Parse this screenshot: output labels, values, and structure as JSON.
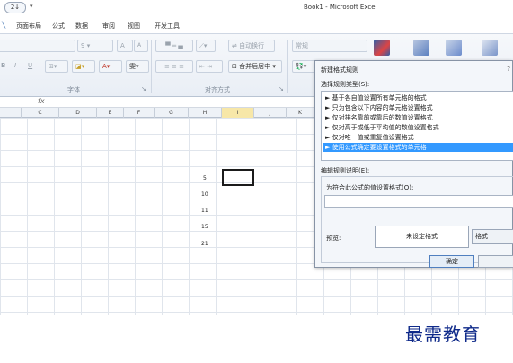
{
  "titlebar": {
    "sort_icon_text": "2↓",
    "title": "Book1 - Microsoft Excel"
  },
  "ribbon": {
    "tabs": [
      "页面布局",
      "公式",
      "数据",
      "审阅",
      "视图",
      "开发工具"
    ],
    "font_size": "9",
    "font_grow": "A",
    "font_shrink": "A",
    "wrap_text": "自动换行",
    "merge_center": "合并后居中",
    "number_format": "常规",
    "group_font": "字体",
    "group_alignment": "对齐方式"
  },
  "columns": [
    "C",
    "D",
    "E",
    "F",
    "G",
    "H",
    "I",
    "J",
    "K"
  ],
  "active_column": "I",
  "cells": [
    {
      "value": "5"
    },
    {
      "value": "10"
    },
    {
      "value": "11"
    },
    {
      "value": "15"
    },
    {
      "value": "21"
    }
  ],
  "dialog": {
    "title": "新建格式规则",
    "close": "?",
    "rule_type_label": "选择规则类型(S):",
    "rule_types": [
      "► 基于各自值设置所有单元格的格式",
      "► 只为包含以下内容的单元格设置格式",
      "► 仅对排名靠前或靠后的数值设置格式",
      "► 仅对高于或低于平均值的数值设置格式",
      "► 仅对唯一值或重复值设置格式",
      "► 使用公式确定要设置格式的单元格"
    ],
    "selected_rule_index": 5,
    "edit_label": "编辑规则说明(E):",
    "formula_label": "为符合此公式的值设置格式(O):",
    "formula_value": "",
    "preview_label": "预览:",
    "preview_text": "未设定格式",
    "format_button": "格式",
    "ok_button": "确定"
  },
  "watermark": "最需教育",
  "colors": {
    "selected_rule": "#3399ff",
    "watermark": "#0f2a8a",
    "active_column": "#f7e7a8"
  }
}
